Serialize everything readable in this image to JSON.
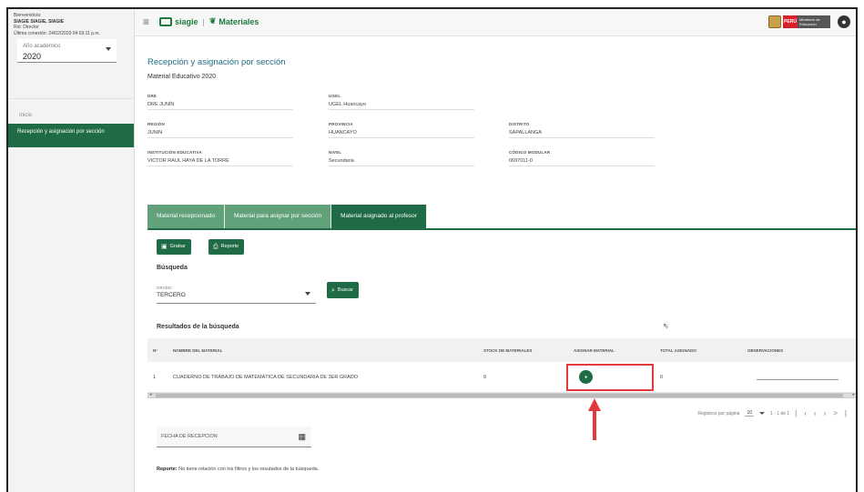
{
  "sidebar": {
    "welcome": "Bienvenido/a:",
    "user_name": "SIAGIE SIAGIE, SIAGIE",
    "role": "Rol: Director",
    "last_login": "Última conexión: 24/02/2020 04:03:11 p.m.",
    "year_label": "Año académico",
    "year_value": "2020",
    "nav": {
      "inicio": "Inicio",
      "active": "Recepción y asignación por sección"
    }
  },
  "topbar": {
    "app_name": "siagie",
    "module": "Materiales",
    "country": "PERÚ",
    "ministry": "Ministerio de Educación"
  },
  "page": {
    "title": "Recepción y asignación por sección",
    "subtitle": "Material Educativo 2020"
  },
  "fields": {
    "dre_label": "DRE",
    "dre_value": "DRE JUNÍN",
    "ugel_label": "UGEL",
    "ugel_value": "UGEL Huancayo",
    "region_label": "REGIÓN",
    "region_value": "JUNIN",
    "provincia_label": "PROVINCIA",
    "provincia_value": "HUANCAYO",
    "distrito_label": "DISTRITO",
    "distrito_value": "SAPALLANGA",
    "ie_label": "INSTITUCIÓN EDUCATIVA",
    "ie_value": "VICTOR RAUL HAYA DE LA TORRE",
    "nivel_label": "NIVEL",
    "nivel_value": "Secundaria",
    "codigo_label": "CÓDIGO MODULAR",
    "codigo_value": "0697011-0"
  },
  "tabs": [
    {
      "label": "Material recepcionado"
    },
    {
      "label": "Material para asignar por sección"
    },
    {
      "label": "Material asignado al profesor"
    }
  ],
  "actions": {
    "grabar": "Grabar",
    "reporte": "Reporte",
    "buscar": "Buscar"
  },
  "search": {
    "heading": "Búsqueda",
    "grado_label": "GRADO",
    "grado_value": "TERCERO"
  },
  "results": {
    "heading": "Resultados de la búsqueda",
    "columns": [
      "N°",
      "NOMBRE DEL MATERIAL",
      "STOCK DE MATERIALES",
      "ASIGNAR MATERIAL",
      "TOTAL ASIGNADO",
      "OBSERVACIONES"
    ],
    "rows": [
      {
        "n": "1",
        "nombre": "CUADERNO DE TRABAJO DE MATEMÁTICA DE SECUNDARIA DE 3ER GRADO",
        "stock": "9",
        "total": "0"
      }
    ]
  },
  "paginator": {
    "label": "Registros por página",
    "size": "10",
    "range": "1 - 1 de 1"
  },
  "fecha": {
    "label": "FECHA DE RECEPCION"
  },
  "note": {
    "bold": "Reporte:",
    "text": " No tiene relación con los filtros y los resutados de la búsqueda."
  },
  "colors": {
    "primary": "#1f6b45",
    "tab_inactive": "#62a27b",
    "highlight": "#e23a3a",
    "title": "#1f6b85"
  },
  "icons": [
    "hamburger-icon",
    "siagie-logo-icon",
    "materials-icon",
    "user-account-icon",
    "save-icon",
    "print-icon",
    "search-icon",
    "assign-material-icon",
    "calendar-icon"
  ]
}
